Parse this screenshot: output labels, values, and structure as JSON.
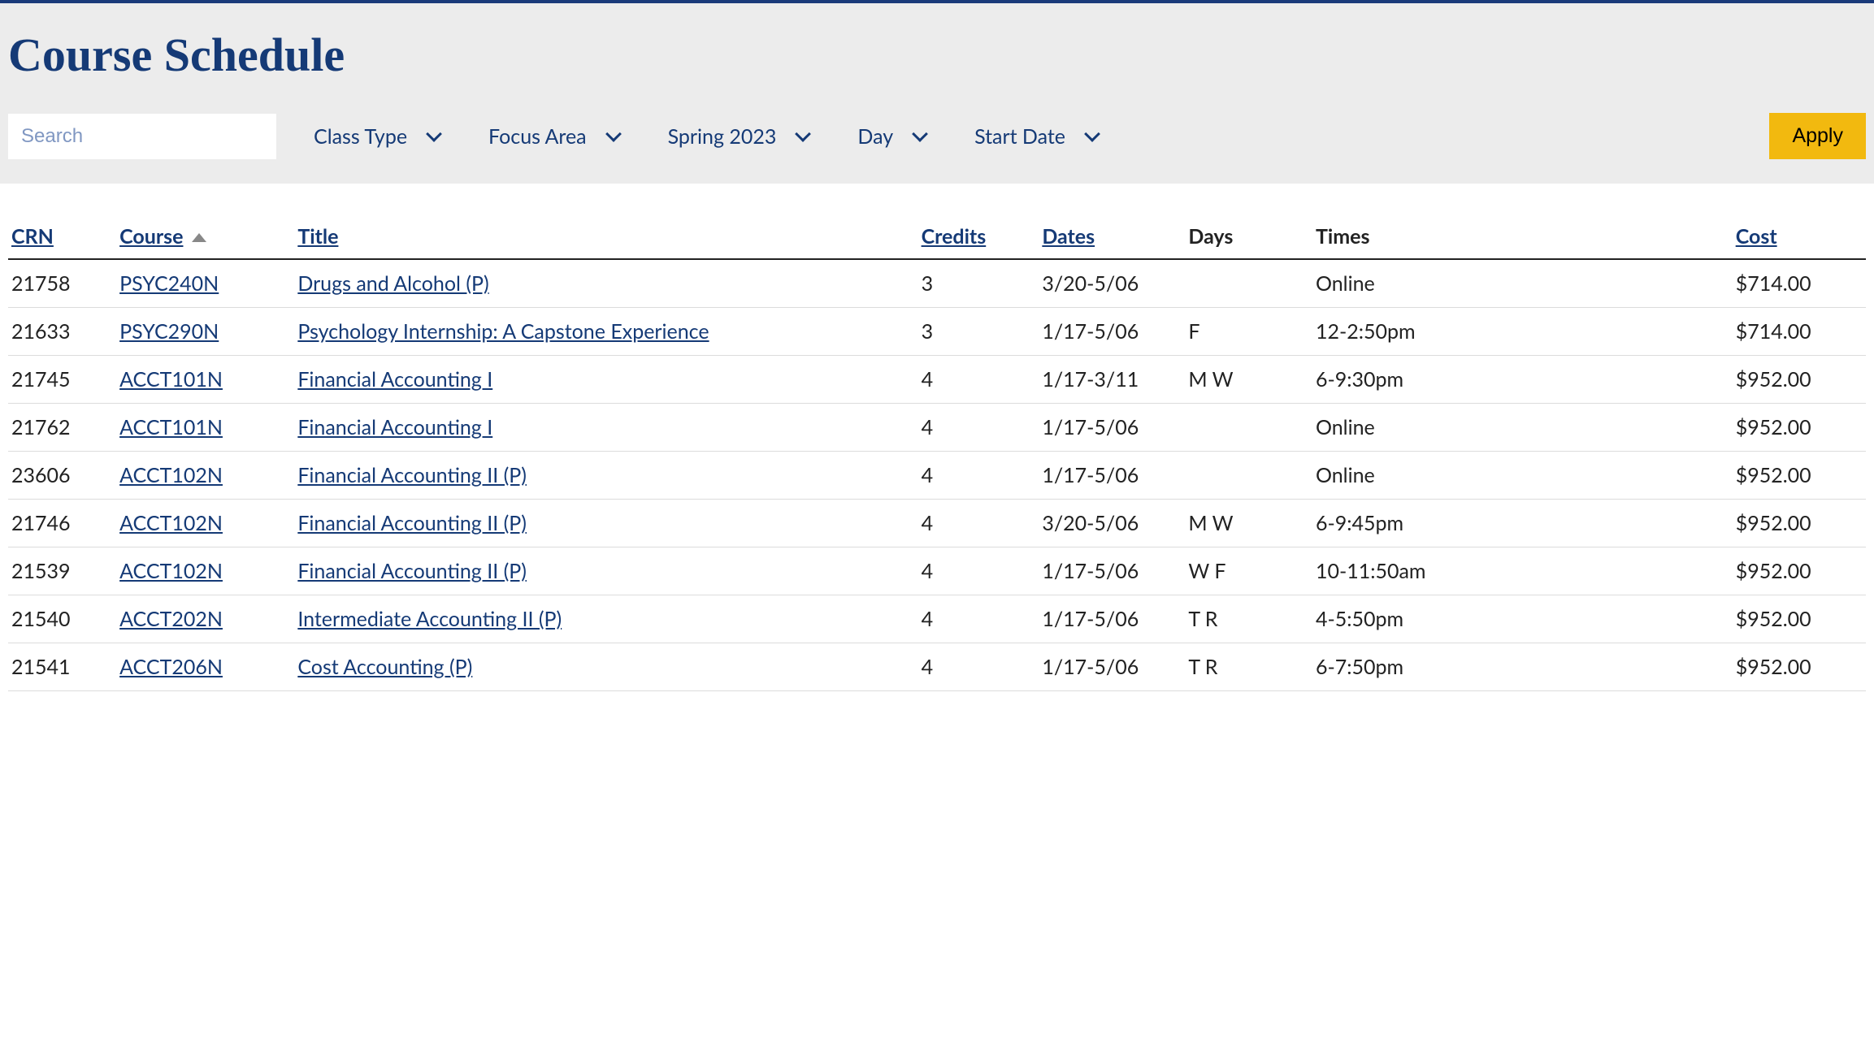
{
  "page_title": "Course Schedule",
  "search_placeholder": "Search",
  "filters": {
    "class_type": "Class Type",
    "focus_area": "Focus Area",
    "term": "Spring 2023",
    "day": "Day",
    "start_date": "Start Date"
  },
  "apply_label": "Apply",
  "columns": {
    "crn": "CRN",
    "course": "Course",
    "title": "Title",
    "credits": "Credits",
    "dates": "Dates",
    "days": "Days",
    "times": "Times",
    "cost": "Cost"
  },
  "rows": [
    {
      "crn": "21758",
      "course": "PSYC240N",
      "title": "Drugs and Alcohol (P)",
      "credits": "3",
      "dates": "3/20-5/06",
      "days": "",
      "times": "Online",
      "cost": "$714.00"
    },
    {
      "crn": "21633",
      "course": "PSYC290N",
      "title": "Psychology Internship: A Capstone Experience",
      "credits": "3",
      "dates": "1/17-5/06",
      "days": "F",
      "times": "12-2:50pm",
      "cost": "$714.00"
    },
    {
      "crn": "21745",
      "course": "ACCT101N",
      "title": "Financial Accounting I",
      "credits": "4",
      "dates": "1/17-3/11",
      "days": "M W",
      "times": "6-9:30pm",
      "cost": "$952.00"
    },
    {
      "crn": "21762",
      "course": "ACCT101N",
      "title": "Financial Accounting I",
      "credits": "4",
      "dates": "1/17-5/06",
      "days": "",
      "times": "Online",
      "cost": "$952.00"
    },
    {
      "crn": "23606",
      "course": "ACCT102N",
      "title": "Financial Accounting II (P)",
      "credits": "4",
      "dates": "1/17-5/06",
      "days": "",
      "times": "Online",
      "cost": "$952.00"
    },
    {
      "crn": "21746",
      "course": "ACCT102N",
      "title": "Financial Accounting II (P)",
      "credits": "4",
      "dates": "3/20-5/06",
      "days": "M W",
      "times": "6-9:45pm",
      "cost": "$952.00"
    },
    {
      "crn": "21539",
      "course": "ACCT102N",
      "title": "Financial Accounting II (P)",
      "credits": "4",
      "dates": "1/17-5/06",
      "days": "W F",
      "times": "10-11:50am",
      "cost": "$952.00"
    },
    {
      "crn": "21540",
      "course": "ACCT202N",
      "title": "Intermediate Accounting II (P)",
      "credits": "4",
      "dates": "1/17-5/06",
      "days": "T R",
      "times": "4-5:50pm",
      "cost": "$952.00"
    },
    {
      "crn": "21541",
      "course": "ACCT206N",
      "title": "Cost Accounting (P)",
      "credits": "4",
      "dates": "1/17-5/06",
      "days": "T R",
      "times": "6-7:50pm",
      "cost": "$952.00"
    }
  ]
}
